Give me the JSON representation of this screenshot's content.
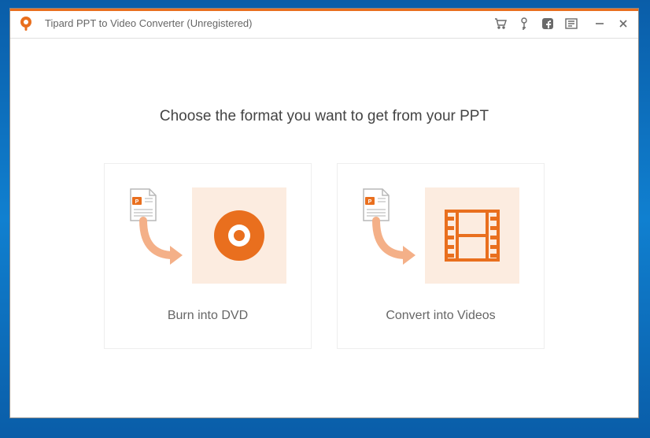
{
  "titlebar": {
    "app_title": "Tipard PPT to Video Converter (Unregistered)"
  },
  "content": {
    "heading": "Choose the format you want to get from your PPT",
    "option_dvd_label": "Burn into DVD",
    "option_video_label": "Convert into Videos"
  }
}
